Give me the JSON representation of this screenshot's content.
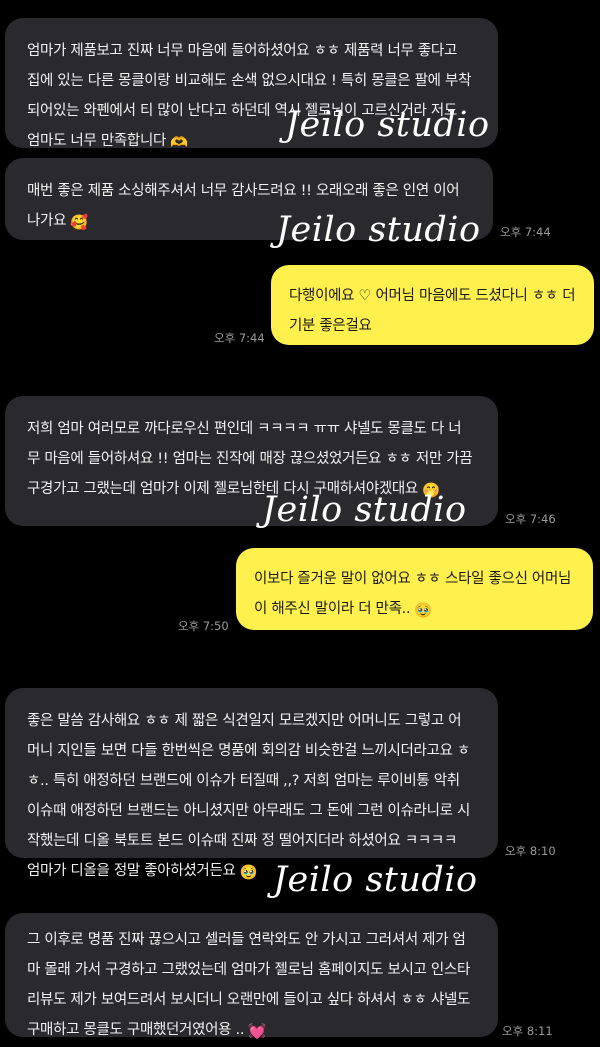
{
  "watermark": "Jeilo studio",
  "messages": [
    {
      "side": "in",
      "text": "엄마가 제품보고 진짜 너무 마음에 들어하셨어요 ㅎㅎ 제품력 너무 좋다고 집에 있는 다른 몽클이랑 비교해도 손색 없으시대요 ! 특히 몽클은 팔에 부착되어있는 와펜에서 티 많이 난다고 하던데 역시 젤로님이 고르신거라 저도 엄마도 너무 만족합니다",
      "emoji": "🫶",
      "time": ""
    },
    {
      "side": "in",
      "text": "매번 좋은 제품 소싱해주셔서 너무 감사드려요 !! 오래오래 좋은 인연 이어나가요",
      "emoji": "🥰",
      "time": "오후 7:44"
    },
    {
      "side": "out",
      "text": "다행이에요 ♡ 어머님 마음에도 드셨다니 ㅎㅎ 더 기분 좋은걸요",
      "emoji": "",
      "time": "오후 7:44"
    },
    {
      "side": "in",
      "text": "저희 엄마 여러모로 까다로우신 편인데 ㅋㅋㅋㅋ ㅠㅠ 샤넬도 몽클도 다 너무 마음에 들어하셔요 !! 엄마는 진작에 매장 끊으셨었거든요 ㅎㅎ 저만 가끔 구경가고 그랬는데 엄마가 이제 젤로님한테 다시 구매하셔야겠대요",
      "emoji": "🤭",
      "time": "오후 7:46"
    },
    {
      "side": "out",
      "text": "이보다 즐거운 말이 없어요 ㅎㅎ 스타일 좋으신 어머님이 해주신 말이라 더 만족..",
      "emoji": "🥹",
      "time": "오후 7:50"
    },
    {
      "side": "in",
      "text": "좋은 말씀 감사해요 ㅎㅎ 제 짧은 식견일지 모르겠지만 어머니도 그렇고 어머니 지인들 보면 다들 한번씩은 명품에 회의감 비슷한걸 느끼시더라고요 ㅎㅎ.. 특히 애정하던 브랜드에 이슈가 터질때 ,,? 저희 엄마는 루이비통 악취 이슈때 애정하던 브랜드는 아니셨지만 아무래도 그 돈에 그런 이슈라니로 시작했는데 디올 북토트 본드 이슈때 진짜 정 떨어지더라 하셨어요 ㅋㅋㅋㅋ 엄마가 디올을 정말 좋아하셨거든요",
      "emoji": "🥹",
      "time": "오후 8:10"
    },
    {
      "side": "in",
      "text": "그 이후로 명품 진짜 끊으시고 셀러들 연락와도 안 가시고 그러셔서 제가 엄마 몰래 가서 구경하고 그랬었는데 엄마가 젤로님 홈페이지도 보시고 인스타 리뷰도 제가 보여드려서 보시더니 오랜만에 들이고 싶다 하셔서 ㅎㅎ 샤넬도 구매하고 몽클도 구매했던거였어용 ..",
      "emoji": "💓",
      "time": "오후 8:11"
    }
  ]
}
